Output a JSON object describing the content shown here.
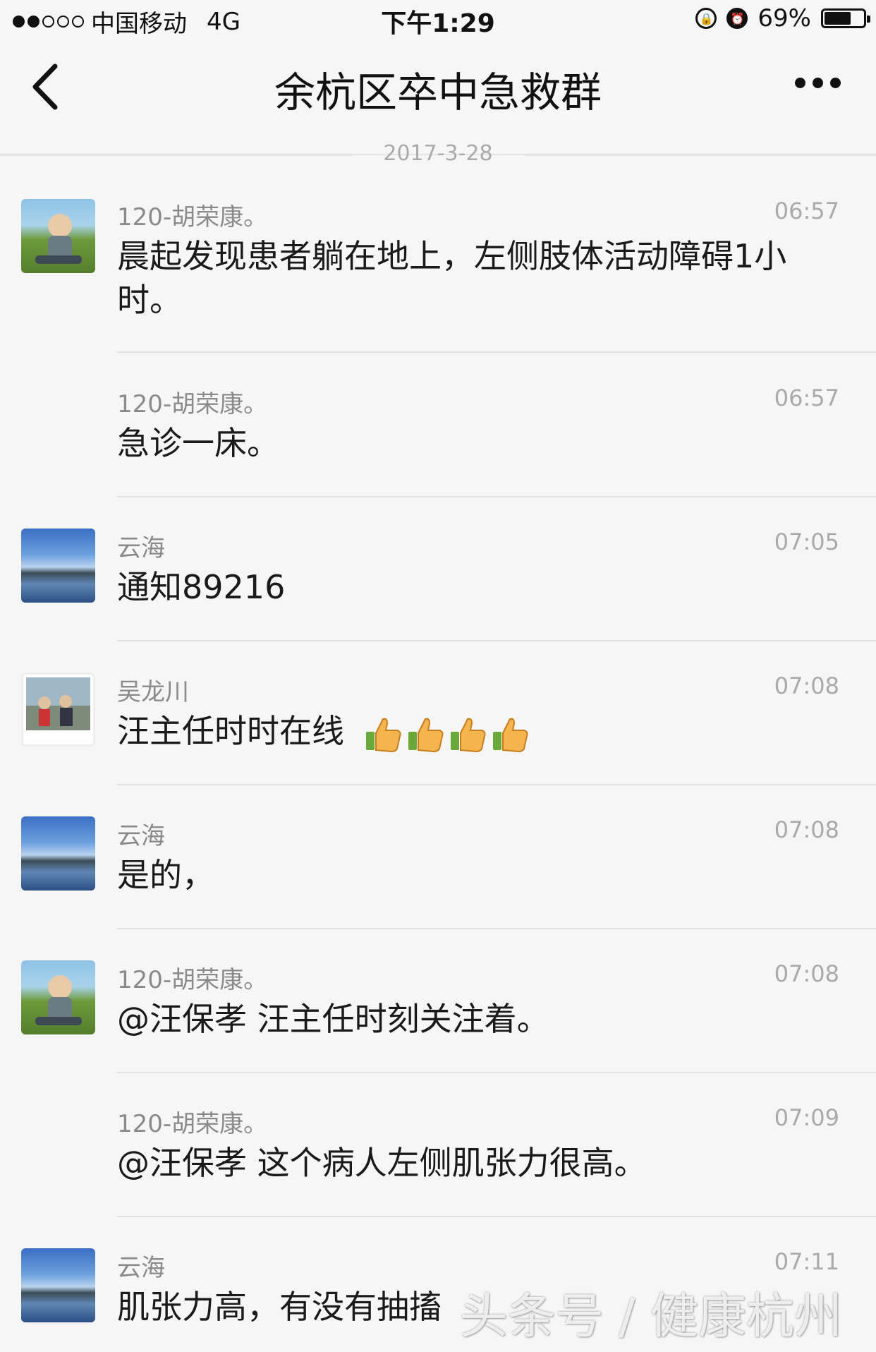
{
  "status_bar": {
    "carrier": "中国移动",
    "network": "4G",
    "time": "下午1:29",
    "battery": "69%",
    "battery_level": 0.69,
    "signal_bars_filled": 2,
    "signal_bars_total": 5
  },
  "header": {
    "title": "余杭区卒中急救群",
    "back_icon": "chevron-left-icon",
    "more_icon": "more-dots-icon"
  },
  "date_separator": "2017-3-28",
  "messages": [
    {
      "sender": "120-胡荣康。",
      "time": "06:57",
      "text": "晨起发现患者躺在地上，左侧肢体活动障碍1小时。",
      "avatar": "child-on-grass"
    },
    {
      "sender": "120-胡荣康。",
      "time": "06:57",
      "text": "急诊一床。",
      "avatar": ""
    },
    {
      "sender": "云海",
      "time": "07:05",
      "text": "通知89216",
      "avatar": "sea-landscape"
    },
    {
      "sender": "吴龙川",
      "time": "07:08",
      "text": "汪主任时时在线",
      "avatar": "family-photo",
      "emoji": "thumbs-up x4"
    },
    {
      "sender": "云海",
      "time": "07:08",
      "text": "是的，",
      "avatar": "sea-landscape"
    },
    {
      "sender": "120-胡荣康。",
      "time": "07:08",
      "text": "@汪保孝 汪主任时刻关注着。",
      "avatar": "child-on-grass"
    },
    {
      "sender": "120-胡荣康。",
      "time": "07:09",
      "text": "@汪保孝 这个病人左侧肌张力很高。",
      "avatar": ""
    },
    {
      "sender": "云海",
      "time": "07:11",
      "text": "肌张力高，有没有抽搐",
      "avatar": "sea-landscape"
    }
  ],
  "watermark": "头条号 / 健康杭州",
  "colors": {
    "background": "#f6f6f6",
    "divider": "#e2e2e2",
    "sender": "#8a8a8a",
    "time": "#aaaaaa"
  }
}
